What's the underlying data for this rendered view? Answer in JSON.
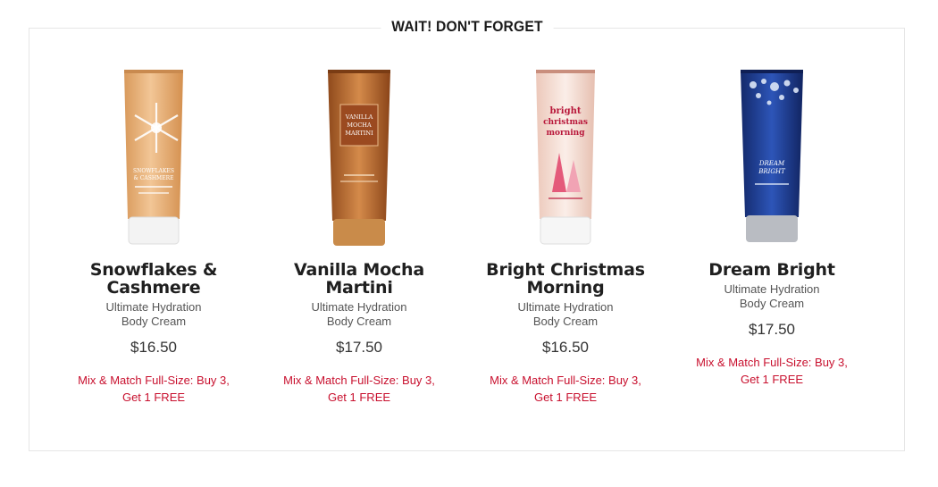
{
  "heading": "WAIT! DON'T FORGET",
  "products": [
    {
      "name": "Snowflakes & Cashmere",
      "type": "Ultimate Hydration Body Cream",
      "price": "$16.50",
      "promo": "Mix & Match Full-Size: Buy 3, Get 1 FREE",
      "tube_label": "SNOWFLAKES & CASHMERE",
      "tube_color": "#e8b27a",
      "cap_color": "#ffffff",
      "icon": "snowflake-tube-image"
    },
    {
      "name": "Vanilla Mocha Martini",
      "type": "Ultimate Hydration Body Cream",
      "price": "$17.50",
      "promo": "Mix & Match Full-Size: Buy 3, Get 1 FREE",
      "tube_label": "VANILLA MOCHA MARTINI",
      "tube_color": "#b5652a",
      "cap_color": "#c98b4a",
      "icon": "mocha-tube-image"
    },
    {
      "name": "Bright Christmas Morning",
      "type": "Ultimate Hydration Body Cream",
      "price": "$16.50",
      "promo": "Mix & Match Full-Size: Buy 3, Get 1 FREE",
      "tube_label": "bright christmas morning",
      "tube_color": "#f4d9cf",
      "cap_color": "#ffffff",
      "icon": "christmas-tube-image"
    },
    {
      "name": "Dream Bright",
      "type": "Ultimate Hydration Body Cream",
      "price": "$17.50",
      "promo": "Mix & Match Full-Size: Buy 3, Get 1 FREE",
      "tube_label": "DREAM BRIGHT",
      "tube_color": "#1f3d8f",
      "cap_color": "#b9bcc2",
      "icon": "dream-bright-tube-image"
    }
  ]
}
